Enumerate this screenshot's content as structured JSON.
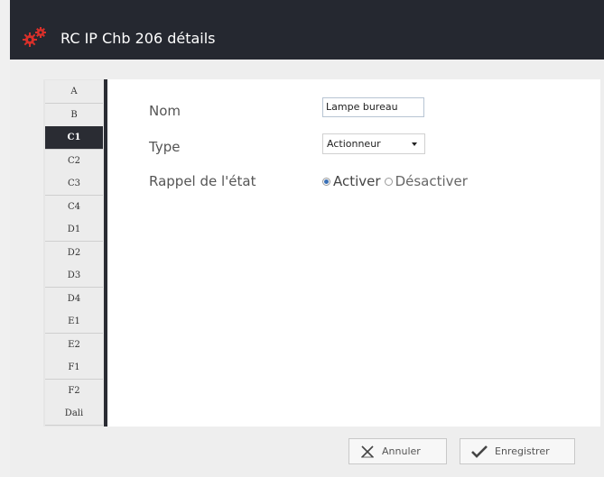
{
  "window": {
    "title": "RC IP Chb 206 détails"
  },
  "tabs": [
    {
      "label": "A",
      "active": false
    },
    {
      "label": "B",
      "active": false
    },
    {
      "label": "C1",
      "active": true
    },
    {
      "label": "C2",
      "active": false
    },
    {
      "label": "C3",
      "active": false
    },
    {
      "label": "C4",
      "active": false
    },
    {
      "label": "D1",
      "active": false
    },
    {
      "label": "D2",
      "active": false
    },
    {
      "label": "D3",
      "active": false
    },
    {
      "label": "D4",
      "active": false
    },
    {
      "label": "E1",
      "active": false
    },
    {
      "label": "E2",
      "active": false
    },
    {
      "label": "F1",
      "active": false
    },
    {
      "label": "F2",
      "active": false
    },
    {
      "label": "Dali",
      "active": false
    }
  ],
  "form": {
    "name_label": "Nom",
    "name_value": "Lampe bureau",
    "type_label": "Type",
    "type_value": "Actionneur",
    "recall_label": "Rappel de l'état",
    "recall_options": [
      {
        "label": "Activer",
        "selected": true
      },
      {
        "label": "Désactiver",
        "selected": false
      }
    ]
  },
  "footer": {
    "cancel_label": "Annuler",
    "save_label": "Enregistrer"
  },
  "colors": {
    "titlebar": "#252830",
    "active_tab": "#2a2c33",
    "icon_red": "#d9302a"
  }
}
